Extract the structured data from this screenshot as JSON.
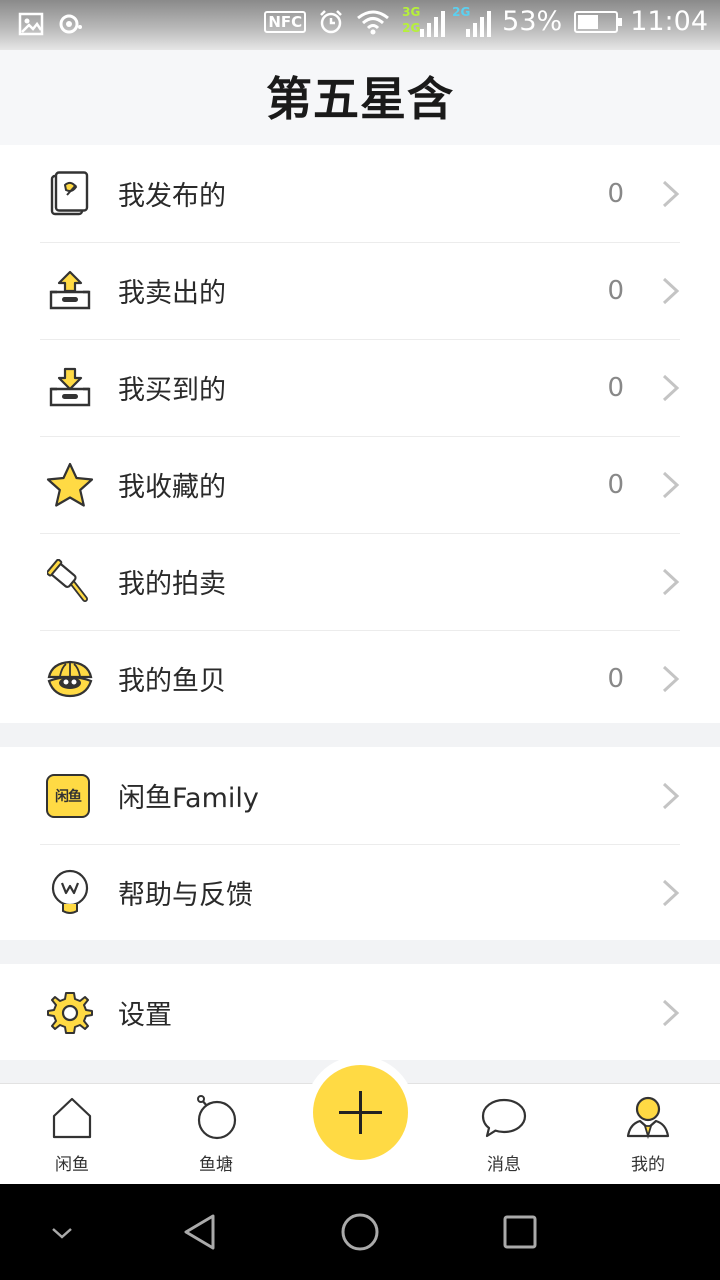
{
  "status_bar": {
    "nfc": "NFC",
    "net1": "3G",
    "net1b": "2G",
    "net2": "2G",
    "battery": "53%",
    "time": "11:04"
  },
  "header": {
    "title": "第五星含"
  },
  "menu_group_1": [
    {
      "label": "我发布的",
      "count": "0",
      "icon": "published-document-icon"
    },
    {
      "label": "我卖出的",
      "count": "0",
      "icon": "sold-upload-tray-icon"
    },
    {
      "label": "我买到的",
      "count": "0",
      "icon": "bought-download-tray-icon"
    },
    {
      "label": "我收藏的",
      "count": "0",
      "icon": "star-icon"
    },
    {
      "label": "我的拍卖",
      "count": "",
      "icon": "auction-hammer-icon"
    },
    {
      "label": "我的鱼贝",
      "count": "0",
      "icon": "shell-icon"
    }
  ],
  "menu_group_2": [
    {
      "label": "闲鱼Family",
      "icon": "xianyu-family-icon",
      "icon_text": "闲鱼"
    },
    {
      "label": "帮助与反馈",
      "icon": "lightbulb-help-icon"
    }
  ],
  "menu_group_3": [
    {
      "label": "设置",
      "icon": "gear-icon"
    }
  ],
  "tab_bar": [
    {
      "label": "闲鱼",
      "icon": "home-icon"
    },
    {
      "label": "鱼塘",
      "icon": "pond-icon"
    },
    {
      "label": "",
      "icon": "plus-icon"
    },
    {
      "label": "消息",
      "icon": "message-bubble-icon"
    },
    {
      "label": "我的",
      "icon": "profile-icon"
    }
  ],
  "colors": {
    "accent": "#ffda44",
    "text": "#2a2a2a",
    "count": "#888888",
    "background": "#f2f3f5"
  }
}
